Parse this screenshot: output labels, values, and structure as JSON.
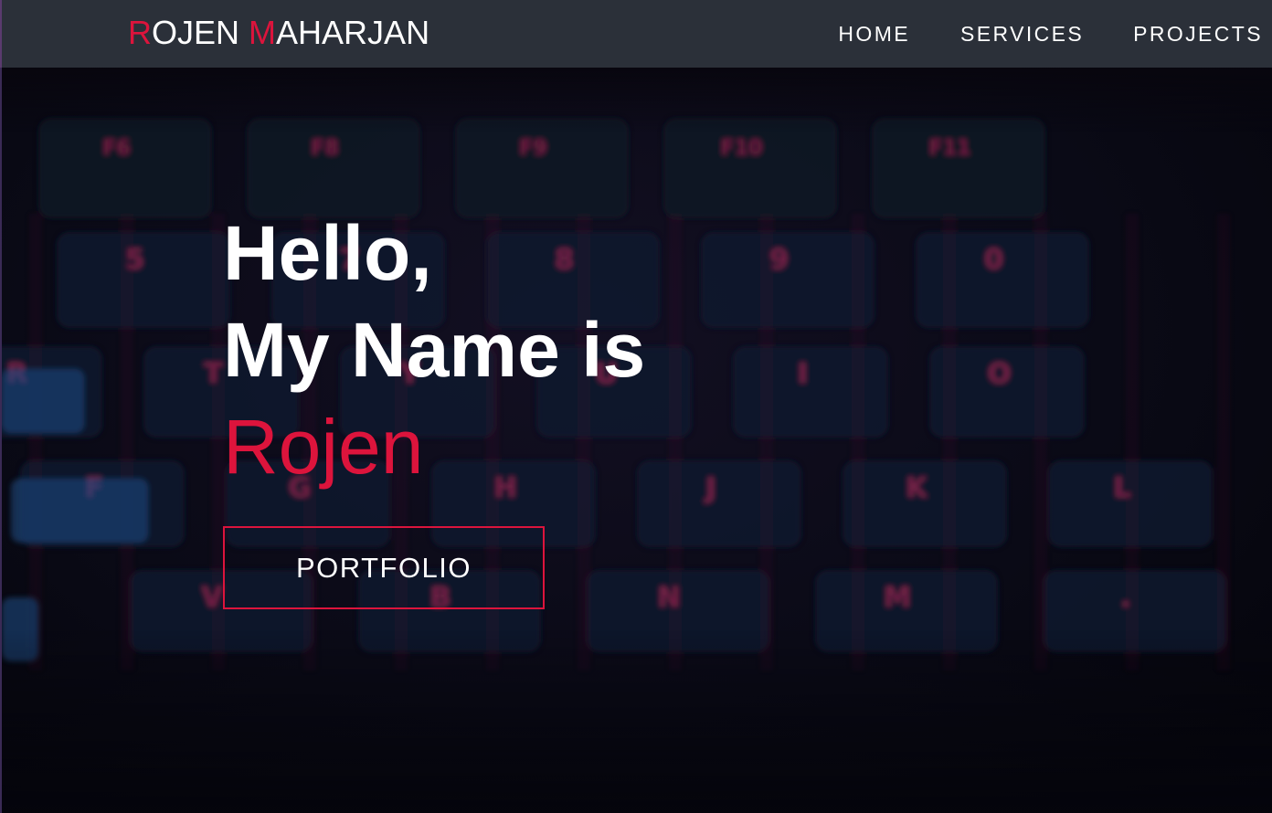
{
  "brand": {
    "initial_first": "R",
    "rest_first": "OJEN",
    "initial_last": "M",
    "rest_last": "AHARJAN",
    "accent_color": "#dc143c"
  },
  "nav": {
    "items": [
      {
        "label": "HOME"
      },
      {
        "label": "SERVICES"
      },
      {
        "label": "PROJECTS"
      }
    ]
  },
  "hero": {
    "greeting": "Hello,",
    "intro": "My Name is",
    "name": "Rojen",
    "button_label": "PORTFOLIO",
    "key_legends": [
      "F6",
      "F8",
      "F9",
      "F10",
      "F11",
      "5",
      "7",
      "8",
      "9",
      "0",
      "R",
      "T",
      "Y",
      "U",
      "I",
      "O",
      "F",
      "G",
      "H",
      "J",
      "K",
      "L",
      "V",
      "B",
      "N",
      "M",
      "."
    ]
  },
  "colors": {
    "navbar_bg": "#2b3039",
    "accent": "#dc143c",
    "text": "#ffffff",
    "hero_bg": "#0a0a16"
  }
}
